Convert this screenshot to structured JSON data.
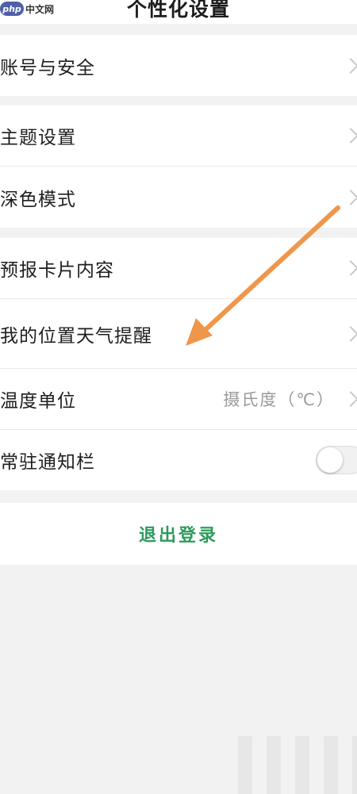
{
  "header": {
    "title": "个性化设置"
  },
  "watermark": {
    "logo": "php",
    "text": "中文网"
  },
  "groups": [
    {
      "items": [
        {
          "label": "账号与安全"
        }
      ]
    },
    {
      "items": [
        {
          "label": "主题设置"
        },
        {
          "label": "深色模式"
        }
      ]
    },
    {
      "items": [
        {
          "label": "预报卡片内容"
        },
        {
          "label": "我的位置天气提醒"
        },
        {
          "label": "温度单位",
          "value": "摄氏度（℃）"
        },
        {
          "label": "常驻通知栏",
          "toggle": false
        }
      ]
    }
  ],
  "logout": {
    "label": "退出登录"
  },
  "colors": {
    "accent": "#2e9a5c",
    "arrow": "#f0964a"
  },
  "icons": {
    "chevron": "chevron-right-icon",
    "arrow": "annotation-arrow-icon"
  }
}
